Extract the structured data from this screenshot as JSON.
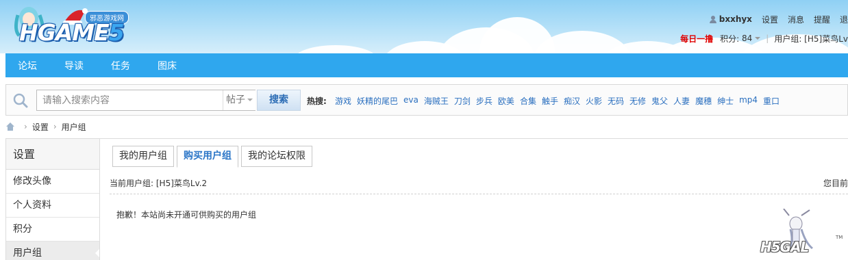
{
  "header": {
    "logo_main": "HGAME",
    "logo_num": "5",
    "logo_sub": "邪恶游戏网",
    "username": "bxxhyx",
    "top_links": [
      "设置",
      "消息",
      "提醒",
      "退"
    ],
    "daily_label": "每日一撸",
    "points_label": "积分:",
    "points_value": "84",
    "separator": "|",
    "group_label": "用户组: [H5]菜鸟Lv"
  },
  "nav": {
    "items": [
      "论坛",
      "导读",
      "任务",
      "图床"
    ]
  },
  "search": {
    "placeholder": "请输入搜索内容",
    "type": "帖子",
    "button": "搜索",
    "hot_label": "热搜:",
    "hot_items": [
      "游戏",
      "妖精的尾巴",
      "eva",
      "海贼王",
      "刀剑",
      "步兵",
      "欧美",
      "合集",
      "触手",
      "痴汉",
      "火影",
      "无码",
      "无修",
      "鬼父",
      "人妻",
      "魔穗",
      "绅士",
      "mp4",
      "重口"
    ]
  },
  "breadcrumb": {
    "items": [
      "设置",
      "用户组"
    ],
    "separator": "›"
  },
  "sidebar": {
    "title": "设置",
    "items": [
      "修改头像",
      "个人资料",
      "积分",
      "用户组"
    ]
  },
  "main": {
    "tabs": [
      "我的用户组",
      "购买用户组",
      "我的论坛权限"
    ],
    "current_group": "当前用户组: [H5]菜鸟Lv.2",
    "right_text": "您目前",
    "message": "抱歉！本站尚未开通可供购买的用户组"
  },
  "mascot": {
    "text": "H5GAL",
    "tm": "TM"
  },
  "colors": {
    "nav_bg": "#2fa7ee",
    "link": "#2a6fbf",
    "daily": "#e00000"
  }
}
